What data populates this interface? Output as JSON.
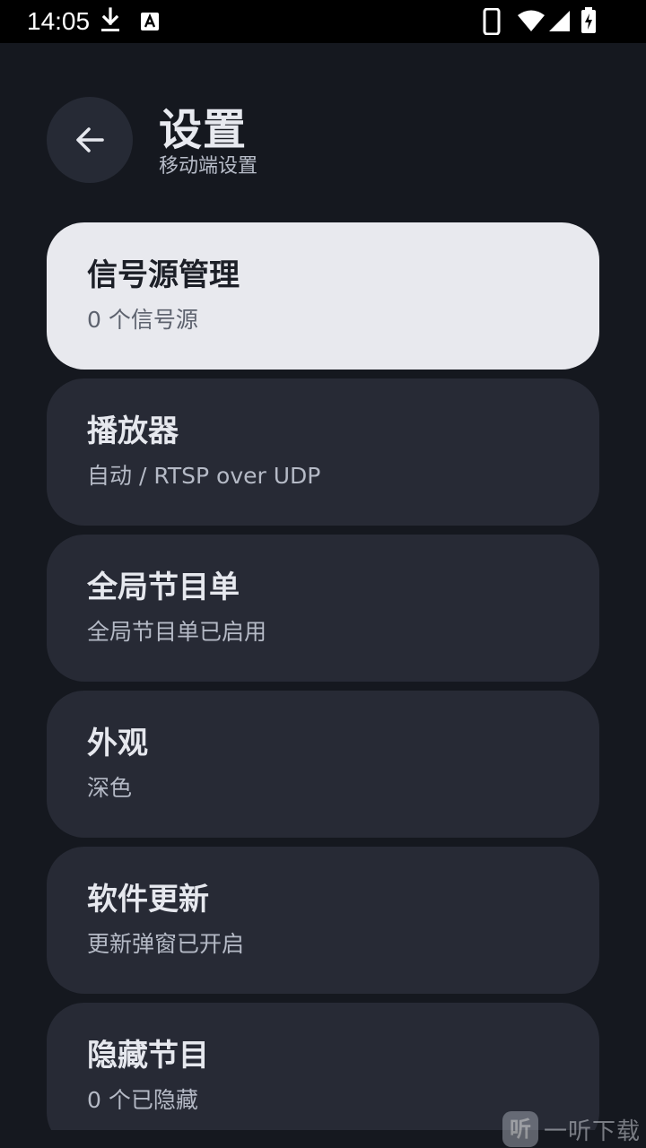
{
  "status_bar": {
    "time": "14:05",
    "icons": [
      "download-icon",
      "a-notification-icon",
      "phone-icon",
      "wifi-icon",
      "signal-icon",
      "battery-charging-icon"
    ]
  },
  "header": {
    "title": "设置",
    "subtitle": "移动端设置",
    "back_icon": "arrow-left-icon"
  },
  "settings": [
    {
      "title": "信号源管理",
      "subtitle": "0 个信号源"
    },
    {
      "title": "播放器",
      "subtitle": "自动 / RTSP over UDP"
    },
    {
      "title": "全局节目单",
      "subtitle": "全局节目单已启用"
    },
    {
      "title": "外观",
      "subtitle": "深色"
    },
    {
      "title": "软件更新",
      "subtitle": "更新弹窗已开启"
    },
    {
      "title": "隐藏节目",
      "subtitle": "0 个已隐藏"
    }
  ],
  "watermark": {
    "logo_text": "听",
    "text": "一听下载"
  },
  "colors": {
    "background": "#15181f",
    "card": "#272a35",
    "card_selected": "#e8e9ee",
    "text_primary": "#e6e8ee",
    "text_secondary": "#b5bac6"
  }
}
